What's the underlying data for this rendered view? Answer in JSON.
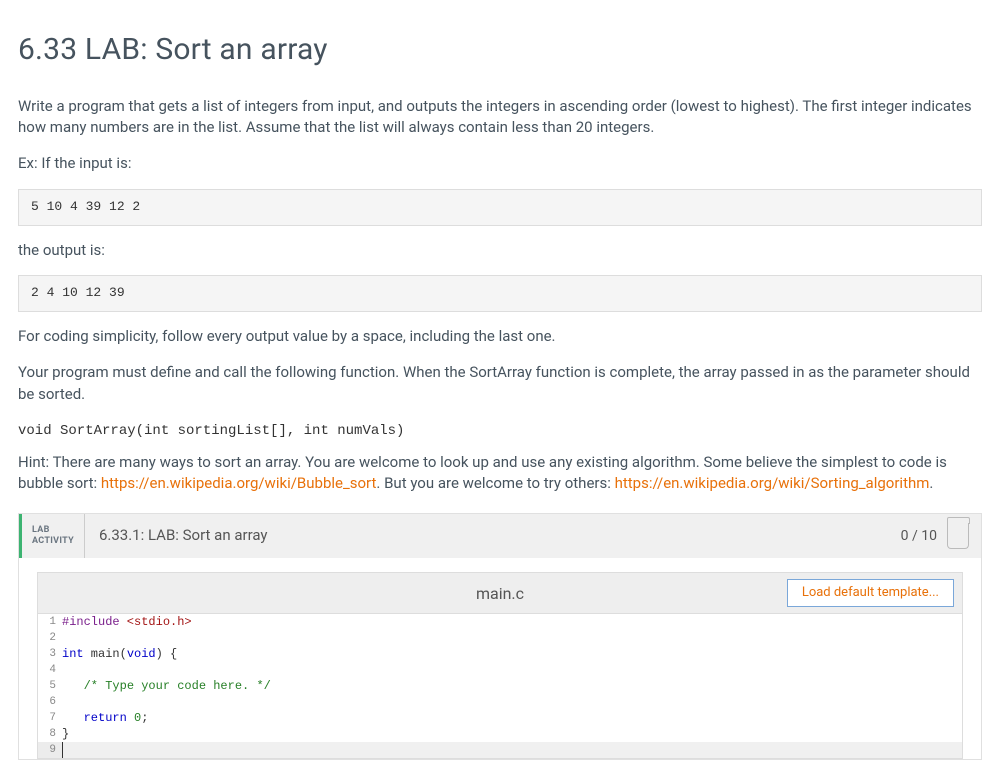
{
  "title": "6.33 LAB: Sort an array",
  "intro": "Write a program that gets a list of integers from input, and outputs the integers in ascending order (lowest to highest). The first integer indicates how many numbers are in the list. Assume that the list will always contain less than 20 integers.",
  "ex_label": "Ex: If the input is:",
  "input_example": "5 10 4 39 12 2",
  "output_label": "the output is:",
  "output_example": "2 4 10 12 39",
  "simplicity": "For coding simplicity, follow every output value by a space, including the last one.",
  "func_desc": "Your program must define and call the following function. When the SortArray function is complete, the array passed in as the parameter should be sorted.",
  "func_sig": "void SortArray(int sortingList[], int numVals)",
  "hint_pre": "Hint: There are many ways to sort an array. You are welcome to look up and use any existing algorithm. Some believe the simplest to code is bubble sort: ",
  "link1": "https://en.wikipedia.org/wiki/Bubble_sort",
  "hint_mid": ". But you are welcome to try others: ",
  "link2": "https://en.wikipedia.org/wiki/Sorting_algorithm",
  "hint_end": ".",
  "lab": {
    "activity_l1": "LAB",
    "activity_l2": "ACTIVITY",
    "title": "6.33.1: LAB: Sort an array",
    "score": "0 / 10",
    "filename": "main.c",
    "load_btn": "Load default template..."
  },
  "code": {
    "l1_a": "#include",
    "l1_b": " <stdio.h>",
    "l3_a": "int",
    "l3_b": " main(",
    "l3_c": "void",
    "l3_d": ") {",
    "l5_a": "   ",
    "l5_b": "/* Type your code here. */",
    "l7_a": "   ",
    "l7_b": "return",
    "l7_c": " ",
    "l7_d": "0",
    "l7_e": ";",
    "l8": "}"
  },
  "linenums": [
    "1",
    "2",
    "3",
    "4",
    "5",
    "6",
    "7",
    "8",
    "9"
  ]
}
